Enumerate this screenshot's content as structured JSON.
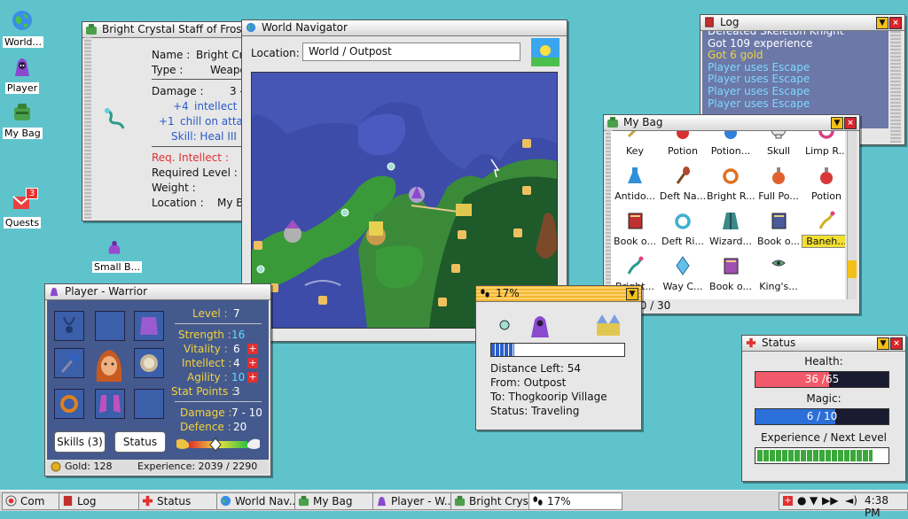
{
  "desktop_icons": [
    {
      "label": "World...",
      "icon": "globe-icon"
    },
    {
      "label": "Player",
      "icon": "wizard-icon"
    },
    {
      "label": "My Bag",
      "icon": "bag-icon"
    },
    {
      "label": "Quests",
      "icon": "mail-icon",
      "badge": "3"
    },
    {
      "label": "Small B...",
      "icon": "small-bag-icon"
    }
  ],
  "item_window": {
    "title": "Bright Crystal Staff of Frost",
    "name_label": "Name :",
    "name_value": "Bright Crys",
    "type_label": "Type :",
    "type_value": "Weapo",
    "damage_label": "Damage :",
    "damage_value": "3 -",
    "bonus1_num": "+4",
    "bonus1_text": "intellect",
    "bonus2_num": "+1",
    "bonus2_text": "chill on attack",
    "skill": "Skill: Heal III",
    "req": "Req. Intellect :",
    "req_level_label": "Required Level :",
    "weight_label": "Weight :",
    "location_label": "Location :",
    "location_value": "My Ba"
  },
  "navigator": {
    "title": "World Navigator",
    "location_label": "Location:",
    "location_value": "World / Outpost"
  },
  "log": {
    "title": "Log",
    "lines": [
      {
        "text": "Defeated Skeleton Knight",
        "color": "#ffffff"
      },
      {
        "text": "Got 109 experience",
        "color": "#ffffff"
      },
      {
        "text": "Got 6 gold",
        "color": "#f2d23c"
      },
      {
        "text": "Player uses Escape",
        "color": "#7fd8ff"
      },
      {
        "text": "Player uses Escape",
        "color": "#7fd8ff"
      },
      {
        "text": "Player uses Escape",
        "color": "#7fd8ff"
      },
      {
        "text": "Player uses Escape",
        "color": "#7fd8ff"
      }
    ]
  },
  "bag": {
    "title": "My Bag",
    "items": [
      {
        "label": "Key",
        "icon": "key-icon",
        "color": "#c8a040"
      },
      {
        "label": "Potion",
        "icon": "potion-icon",
        "color": "#d83030"
      },
      {
        "label": "Potion...",
        "icon": "potion-icon",
        "color": "#3080d8"
      },
      {
        "label": "Skull",
        "icon": "skull-icon",
        "color": "#e8e8e8"
      },
      {
        "label": "Limp R...",
        "icon": "ring-icon",
        "color": "#d84080"
      },
      {
        "label": "Antido...",
        "icon": "flask-icon",
        "color": "#3090d8"
      },
      {
        "label": "Deft Na...",
        "icon": "club-icon",
        "color": "#b04830"
      },
      {
        "label": "Bright R...",
        "icon": "ring-icon",
        "color": "#e07020"
      },
      {
        "label": "Full Po...",
        "icon": "potion-icon",
        "color": "#e06030"
      },
      {
        "label": "Potion",
        "icon": "potion-icon",
        "color": "#d83838"
      },
      {
        "label": "Book o...",
        "icon": "book-icon",
        "color": "#c03030"
      },
      {
        "label": "Deft Ri...",
        "icon": "ring-icon",
        "color": "#40b0d0"
      },
      {
        "label": "Wizard...",
        "icon": "robe-icon",
        "color": "#3a8a8a"
      },
      {
        "label": "Book o...",
        "icon": "book-icon",
        "color": "#4a5a9a"
      },
      {
        "label": "Baneh...",
        "icon": "staff-icon",
        "color": "#d0b020"
      },
      {
        "label": "Bright...",
        "icon": "staff-icon",
        "color": "#2a9a8a"
      },
      {
        "label": "Way C...",
        "icon": "crystal-icon",
        "color": "#60c0e8"
      },
      {
        "label": "Book o...",
        "icon": "book-icon",
        "color": "#a050b0"
      },
      {
        "label": "King's...",
        "icon": "bow-icon",
        "color": "#6aa870"
      }
    ],
    "weight": "27.80 / 30"
  },
  "player": {
    "title": "Player - Warrior",
    "level_label": "Level :",
    "level": "7",
    "strength_label": "Strength :",
    "strength": "16",
    "vitality_label": "Vitality :",
    "vitality": "6",
    "intellect_label": "Intellect :",
    "intellect": "4",
    "agility_label": "Agility :",
    "agility": "10",
    "stat_points_label": "Stat Points :",
    "stat_points": "3",
    "damage_label": "Damage :",
    "damage": "7 - 10",
    "defence_label": "Defence :",
    "defence": "20",
    "skills_button": "Skills (3)",
    "status_button": "Status",
    "gold": "Gold: 128",
    "experience": "Experience: 2039 / 2290"
  },
  "travel": {
    "title": "17%",
    "progress_fraction": 0.17,
    "distance_label": "Distance Left:",
    "distance": "54",
    "from_label": "From:",
    "from": "Outpost",
    "to_label": "To:",
    "to": "Thogkoorip Village",
    "status_label": "Status:",
    "status": "Traveling"
  },
  "status_win": {
    "title": "Status",
    "health_label": "Health:",
    "health_cur": "36",
    "health_max": "65",
    "health_fraction": 0.554,
    "magic_label": "Magic:",
    "magic_cur": "6",
    "magic_max": "10",
    "magic_fraction": 0.6,
    "exp_label": "Experience / Next Level",
    "exp_fraction": 0.89,
    "sep": "/"
  },
  "taskbar": {
    "items": [
      {
        "label": "Com",
        "icon": "globe-icon"
      },
      {
        "label": "Log",
        "icon": "log-icon"
      },
      {
        "label": "Status",
        "icon": "cross-icon"
      },
      {
        "label": "World Nav...",
        "icon": "globe-icon"
      },
      {
        "label": "My Bag",
        "icon": "bag-icon"
      },
      {
        "label": "Player - W...",
        "icon": "wizard-icon"
      },
      {
        "label": "Bright Crys...",
        "icon": "bag-icon"
      },
      {
        "label": "17%",
        "icon": "footsteps-icon"
      }
    ],
    "clock": "4:38 PM"
  },
  "colors": {
    "desktop": "#5fc3cc",
    "health": "#f05a6a",
    "magic": "#2b6fd8",
    "experience": "#3aa83a",
    "log_bg": "#6b78a8"
  }
}
